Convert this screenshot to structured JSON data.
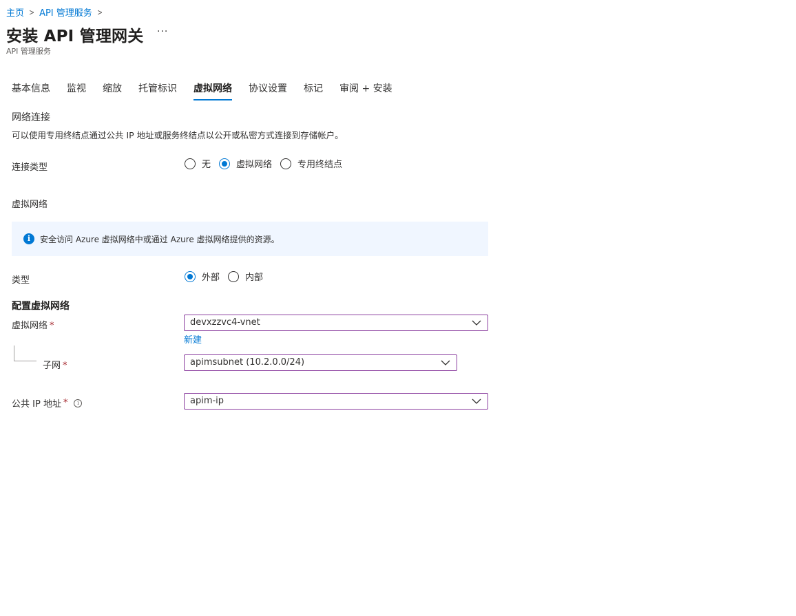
{
  "breadcrumb": {
    "home": "主页",
    "service": "API 管理服务"
  },
  "header": {
    "title": "安装 API 管理网关",
    "more": "···",
    "subtitle": "API 管理服务"
  },
  "tabs": [
    {
      "label": "基本信息",
      "active": false
    },
    {
      "label": "监视",
      "active": false
    },
    {
      "label": "缩放",
      "active": false
    },
    {
      "label": "托管标识",
      "active": false
    },
    {
      "label": "虚拟网络",
      "active": true
    },
    {
      "label": "协议设置",
      "active": false
    },
    {
      "label": "标记",
      "active": false
    },
    {
      "label": "审阅 + 安装",
      "active": false
    }
  ],
  "network": {
    "title": "网络连接",
    "description": "可以使用专用终结点通过公共 IP 地址或服务终结点以公开或私密方式连接到存储帐户。",
    "connection_type_label": "连接类型",
    "connection_options": [
      "无",
      "虚拟网络",
      "专用终结点"
    ],
    "connection_selected": "虚拟网络",
    "vnet_section_label": "虚拟网络"
  },
  "info": {
    "icon": "info-icon",
    "text": "安全访问 Azure 虚拟网络中或通过 Azure 虚拟网络提供的资源。"
  },
  "type": {
    "label": "类型",
    "options": [
      "外部",
      "内部"
    ],
    "selected": "外部"
  },
  "config": {
    "title": "配置虚拟网络",
    "vnet_label": "虚拟网络",
    "vnet_value": "devxzzvc4-vnet",
    "create_new": "新建",
    "subnet_label": "子网",
    "subnet_value": "apimsubnet (10.2.0.0/24)",
    "public_ip_label": "公共 IP 地址",
    "public_ip_value": "apim-ip",
    "required_mark": "*"
  },
  "colors": {
    "accent": "#0078d4",
    "field_border": "#8a3d9e",
    "info_bg": "#f0f6ff",
    "required": "#a4262c"
  }
}
